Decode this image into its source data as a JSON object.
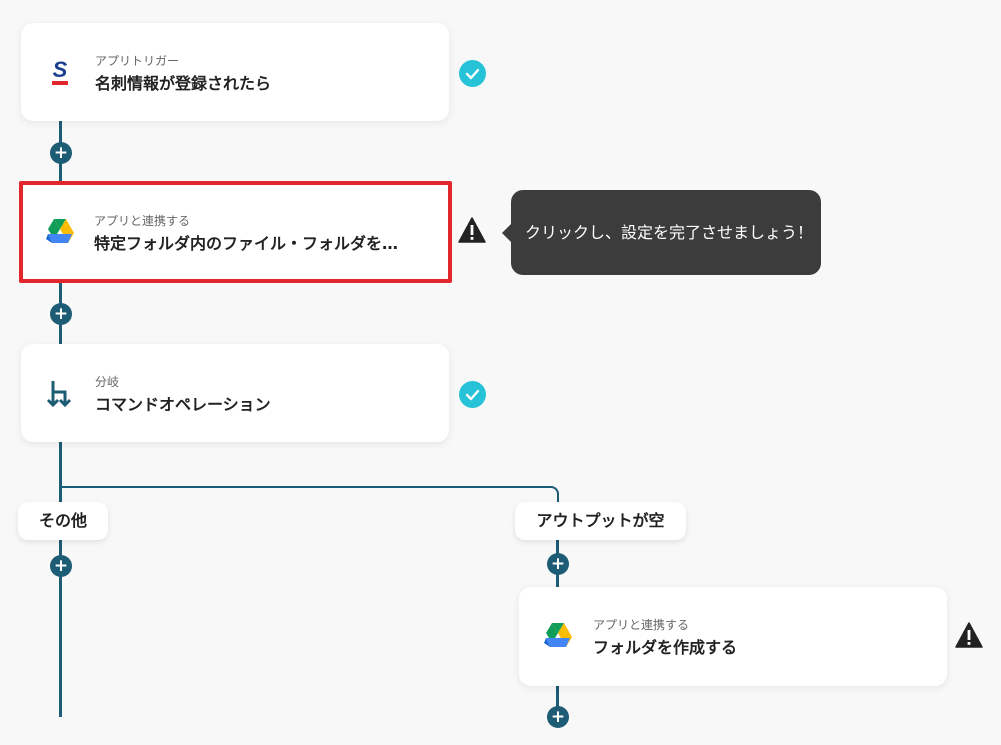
{
  "steps": [
    {
      "sub": "アプリトリガー",
      "title": "名刺情報が登録されたら",
      "status": "complete",
      "icon": "sansan-icon"
    },
    {
      "sub": "アプリと連携する",
      "title": "特定フォルダ内のファイル・フォルダを…",
      "status": "warning",
      "icon": "google-drive-icon"
    },
    {
      "sub": "分岐",
      "title": "コマンドオペレーション",
      "status": "complete",
      "icon": "branch-icon"
    },
    {
      "sub": "アプリと連携する",
      "title": "フォルダを作成する",
      "status": "warning",
      "icon": "google-drive-icon"
    }
  ],
  "tooltip": {
    "text": "クリックし、設定を完了させましょう！"
  },
  "branches": {
    "left": "その他",
    "right": "アウトプットが空"
  },
  "add_symbol": "+",
  "colors": {
    "connector": "#1d5c75",
    "check": "#25c2d8",
    "selected_border": "#e3252c",
    "tooltip_bg": "#3c3c3c"
  }
}
